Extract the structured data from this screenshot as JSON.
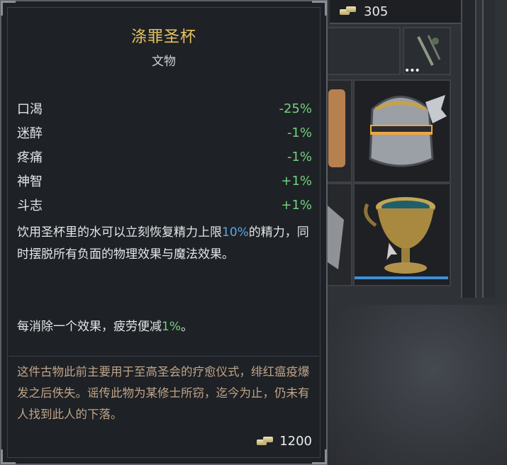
{
  "gold": {
    "amount": "305",
    "icon": "gold-coins-icon"
  },
  "item": {
    "name": "涤罪圣杯",
    "category": "文物",
    "stats": [
      {
        "name": "口渴",
        "value": "-25%"
      },
      {
        "name": "迷醉",
        "value": "-1%"
      },
      {
        "name": "疼痛",
        "value": "-1%"
      },
      {
        "name": "神智",
        "value": "+1%"
      },
      {
        "name": "斗志",
        "value": "+1%"
      }
    ],
    "description": {
      "part1": "饮用圣杯里的水可以立刻恢复精力上限",
      "highlight": "10%",
      "part2": "的精力，同时摆脱所有负面的物理效果与魔法效果。"
    },
    "effect": {
      "part1": "每消除一个效果，疲劳便减",
      "highlight": "1%",
      "part2": "。"
    },
    "lore": "这件古物此前主要用于至高圣会的疗愈仪式，绯红瘟疫爆发之后佚失。谣传此物为某修士所窃，迄今为止，仍未有人找到此人的下落。",
    "price": "1200"
  },
  "colors": {
    "title": "#e6c463",
    "positive": "#72d17e",
    "highlight_blue": "#58a7e6",
    "lore": "#bfa58a"
  }
}
